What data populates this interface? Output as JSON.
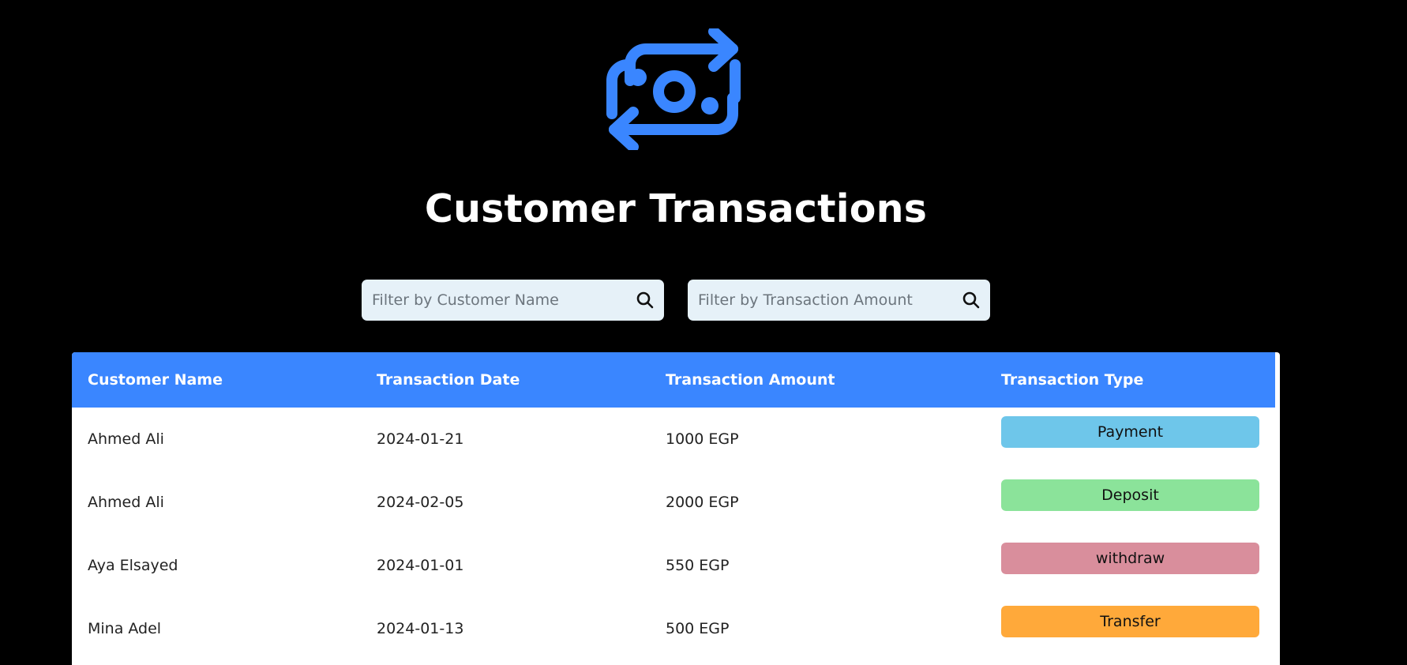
{
  "header": {
    "logo_icon": "money-exchange-icon",
    "title": "Customer Transactions",
    "accent_color": "#3a86ff"
  },
  "filters": {
    "name": {
      "placeholder": "Filter by Customer Name",
      "value": "",
      "icon": "search-icon"
    },
    "amount": {
      "placeholder": "Filter by Transaction Amount",
      "value": "",
      "icon": "search-icon"
    }
  },
  "table": {
    "columns": [
      "Customer Name",
      "Transaction Date",
      "Transaction Amount",
      "Transaction Type"
    ],
    "rows": [
      {
        "name": "Ahmed Ali",
        "date": "2024-01-21",
        "amount": "1000 EGP",
        "type": "Payment",
        "type_color": "#6ec6ea"
      },
      {
        "name": "Ahmed Ali",
        "date": "2024-02-05",
        "amount": "2000 EGP",
        "type": "Deposit",
        "type_color": "#8be39a"
      },
      {
        "name": "Aya Elsayed",
        "date": "2024-01-01",
        "amount": "550 EGP",
        "type": "withdraw",
        "type_color": "#d98e9c"
      },
      {
        "name": "Mina Adel",
        "date": "2024-01-13",
        "amount": "500 EGP",
        "type": "Transfer",
        "type_color": "#ffa93a"
      }
    ]
  }
}
